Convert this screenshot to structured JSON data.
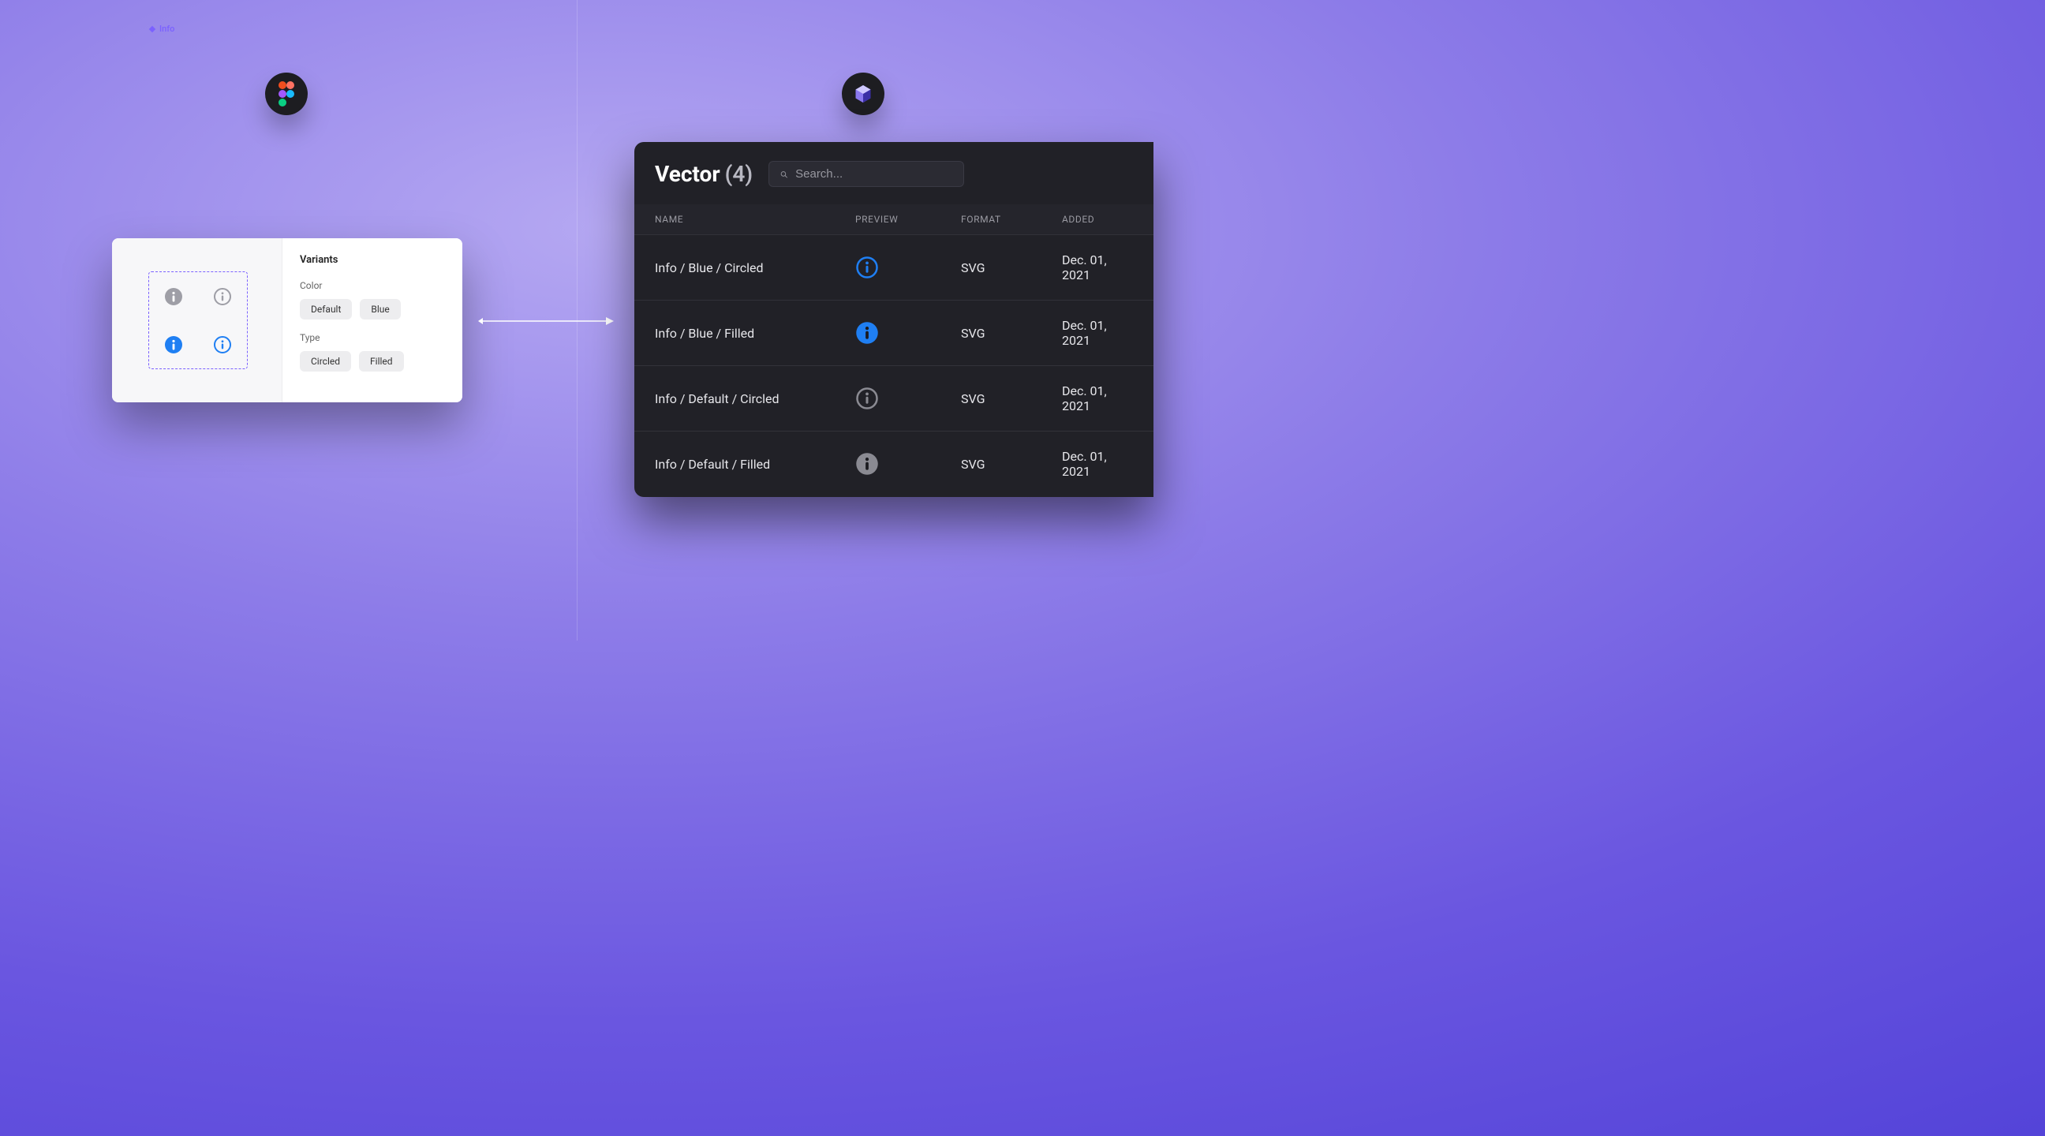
{
  "figma": {
    "component_label": "Info",
    "variants_title": "Variants",
    "groups": [
      {
        "label": "Color",
        "options": [
          "Default",
          "Blue"
        ]
      },
      {
        "label": "Type",
        "options": [
          "Circled",
          "Filled"
        ]
      }
    ]
  },
  "dark": {
    "title": "Vector",
    "count": "(4)",
    "search_placeholder": "Search...",
    "columns": {
      "name": "NAME",
      "preview": "PREVIEW",
      "format": "FORMAT",
      "added": "ADDED"
    },
    "rows": [
      {
        "name": "Info / Blue / Circled",
        "icon": "blue-circled",
        "format": "SVG",
        "added": "Dec. 01, 2021"
      },
      {
        "name": "Info / Blue / Filled",
        "icon": "blue-filled",
        "format": "SVG",
        "added": "Dec. 01, 2021"
      },
      {
        "name": "Info / Default / Circled",
        "icon": "default-circled",
        "format": "SVG",
        "added": "Dec. 01, 2021"
      },
      {
        "name": "Info / Default / Filled",
        "icon": "default-filled",
        "format": "SVG",
        "added": "Dec. 01, 2021"
      }
    ]
  },
  "colors": {
    "blue": "#1f7ff3",
    "gray": "#8a8a92"
  }
}
